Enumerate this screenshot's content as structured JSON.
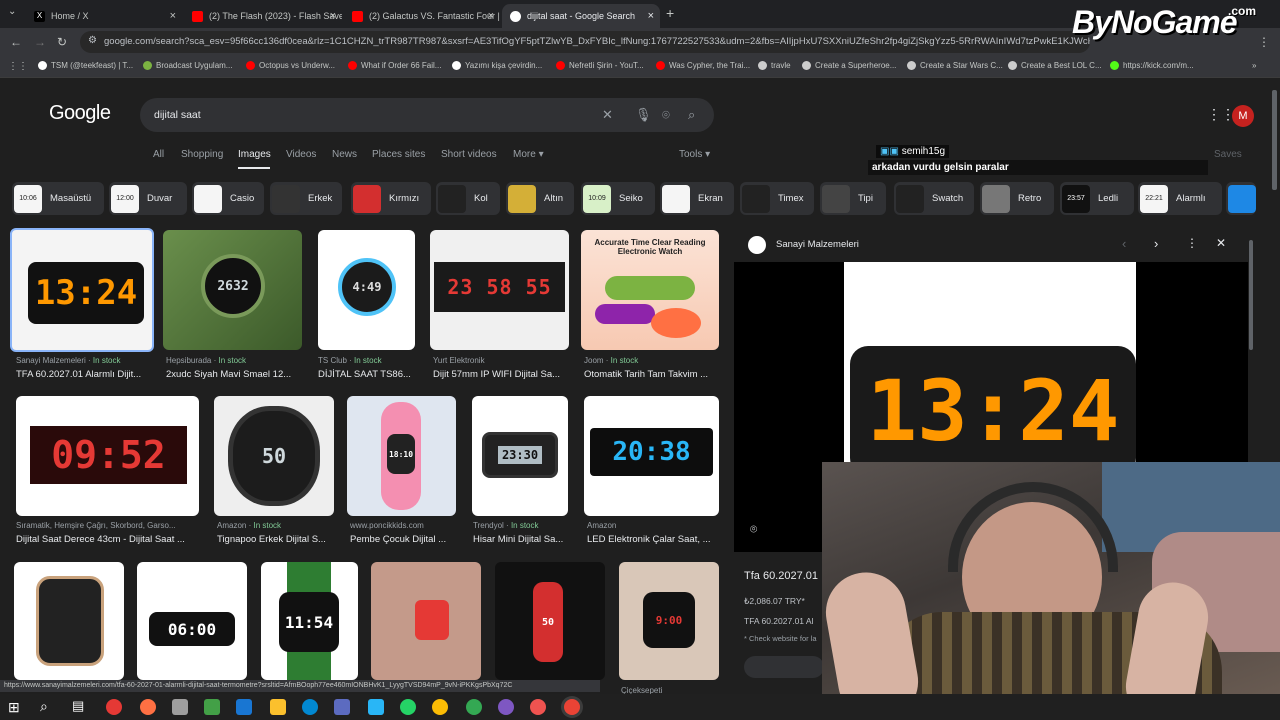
{
  "tabs": [
    {
      "label": "Home / X",
      "color": "#000000"
    },
    {
      "label": "(2) The Flash (2023) - Flash Save",
      "color": "#ff0000"
    },
    {
      "label": "(2) Galactus VS. Fantastic Four |",
      "color": "#ff0000"
    },
    {
      "label": "dijital saat - Google Search",
      "color": "#4285f4"
    }
  ],
  "url": "google.com/search?sca_esv=95f66cc136df0cea&rlz=1C1CHZN_trTR987TR987&sxsrf=AE3TifOgYF5ptTZlwYB_DxFYBIc_lfNung:1767722527533&udm=2&fbs=AIIjpHxU7SXXniUZfeShr2fp4giZjSkgYzz5-5RrRWAInIWd7tzPwkE1KJWcRvaH01...",
  "bookmarks": [
    "TSM (@teekfeast) | T...",
    "Broadcast Uygulam...",
    "Octopus vs Underw...",
    "What if Order 66 Fail...",
    "Yazımı kişa çevirdin...",
    "Nefretli Şirin - YouT...",
    "Was Cypher, the Trai...",
    "travle",
    "Create a Superheroe...",
    "Create a Star Wars C...",
    "Create a Best LOL C...",
    "https://kick.com/m..."
  ],
  "google_logo": "Google",
  "search_query": "dijital saat",
  "nav": [
    "All",
    "Shopping",
    "Images",
    "Videos",
    "News",
    "Places sites",
    "Short videos",
    "More",
    "Tools"
  ],
  "avatar": "M",
  "chips": [
    "Masaüstü",
    "Duvar",
    "Casio",
    "Erkek",
    "Kırmızı",
    "Kol",
    "Altın",
    "Seiko",
    "Ekran",
    "Timex",
    "Tipi",
    "Swatch",
    "Retro",
    "Ledli",
    "Alarmlı"
  ],
  "chat": {
    "user": "semih15g",
    "message": "arkadan vurdu gelsin paralar"
  },
  "saves": "Saves",
  "results": [
    {
      "source": "Sanayi Malzemeleri",
      "stock": "In stock",
      "title": "TFA 60.2027.01 Alarmlı Dijit...",
      "display": "13:24"
    },
    {
      "source": "Hepsiburada",
      "stock": "In stock",
      "title": "2xudc Siyah Mavi Smael 12...",
      "display": "2632"
    },
    {
      "source": "TS Club",
      "stock": "In stock",
      "title": "DİJİTAL SAAT TS86...",
      "display": "4:49"
    },
    {
      "source": "Yurt Elektronik",
      "stock": "",
      "title": "Dijit 57mm IP WIFI Dijital Sa...",
      "display": "23 58 55"
    },
    {
      "source": "Joom",
      "stock": "In stock",
      "title": "Otomatik Tarih Tam Takvim ...",
      "display": "Accurate Time Clear Reading Electronic Watch"
    },
    {
      "source": "Sıramatik, Hemşire Çağrı, Skorbord, Garso...",
      "stock": "",
      "title": "Dijital Saat Derece 43cm - Dijital Saat ...",
      "display": "09:52"
    },
    {
      "source": "Amazon",
      "stock": "In stock",
      "title": "Tignapoo Erkek Dijital S...",
      "display": "50"
    },
    {
      "source": "www.poncikkids.com",
      "stock": "",
      "title": "Pembe Çocuk Dijital ...",
      "display": "18:10"
    },
    {
      "source": "Trendyol",
      "stock": "In stock",
      "title": "Hisar Mini Dijital Sa...",
      "display": "23:30"
    },
    {
      "source": "Amazon",
      "stock": "",
      "title": "LED Elektronik Çalar Saat, ...",
      "display": "20:38"
    }
  ],
  "row3_display": [
    "",
    "06:00",
    "11:54",
    "",
    "50",
    "9:00"
  ],
  "row3_source": "Çiçeksepeti",
  "panel": {
    "source": "Sanayi Malzemeleri",
    "display": "13:24",
    "title": "Tfa 60.2027.01",
    "price": "₺2,086.07 TRY*",
    "subtitle": "TFA 60.2027.01 Al",
    "note": "* Check website for la"
  },
  "status_url": "https://www.sanayimalzemeleri.com/tfa-60-2027-01-alarmli-dijital-saat-termometre?srsltid=AfmBOoph77ee460mIONBHvK1_LyygTVSD94mP_9vN-iPKKgsPbXq72C",
  "watermark": "ByNoGame",
  "watermark_sup": ".com"
}
